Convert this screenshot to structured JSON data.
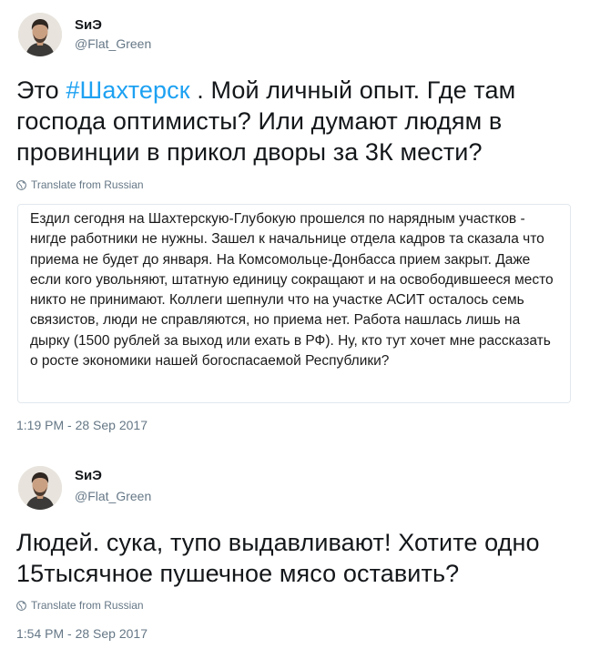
{
  "tweets": [
    {
      "author_name": "SиЭ",
      "author_handle": "@Flat_Green",
      "text_before": "Это ",
      "hashtag": "#Шахтерск",
      "text_after": " . Мой личный опыт. Где там господа оптимисты? Или думают людям в провинции в прикол дворы за 3К мести?",
      "translate_label": "Translate from Russian",
      "quoted_text": "Ездил сегодня на Шахтерскую-Глубокую прошелся по нарядным участков - нигде работники не нужны. Зашел к начальнице отдела кадров та сказала что приема не будет до января. На Комсомольце-Донбасса прием закрыт. Даже если кого увольняют, штатную единицу сокращают и на освободившееся место никто не принимают. Коллеги шепнули что на участке АСИТ осталось семь связистов, люди не справляются, но приема нет. Работа нашлась лишь на дырку (1500 рублей за выход или ехать в РФ). Ну, кто тут хочет мне рассказать о росте экономики нашей богоспасаемой Республики?",
      "timestamp": "1:19 PM - 28 Sep 2017"
    },
    {
      "author_name": "SиЭ",
      "author_handle": "@Flat_Green",
      "text": "Людей. сука, тупо выдавливают! Хотите одно 15тысячное пушечное мясо оставить?",
      "translate_label": "Translate from Russian",
      "timestamp": "1:54 PM - 28 Sep 2017"
    }
  ],
  "colors": {
    "hashtag": "#1da1f2",
    "secondary_text": "#657786",
    "border": "#e1e8ed"
  },
  "icons": {
    "translate": "globe-icon",
    "avatar": "avatar-photo"
  }
}
